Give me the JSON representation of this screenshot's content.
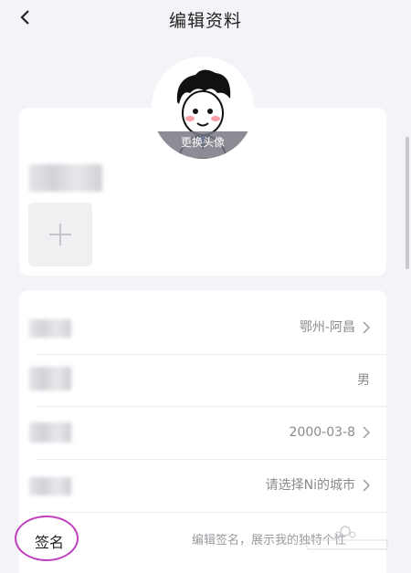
{
  "header": {
    "title": "编辑资料"
  },
  "avatar": {
    "change_label": "更换头像"
  },
  "rows": [
    {
      "value": "鄂州-阿昌"
    },
    {
      "value": "男"
    },
    {
      "value": "2000-03-8"
    },
    {
      "value": "请选择Ni的城市"
    }
  ],
  "signature": {
    "label": "签名",
    "placeholder": "编辑签名，展示我的独特个性"
  },
  "colors": {
    "accent": "#c040c0",
    "background": "#f4f4f8",
    "card": "#ffffff"
  },
  "icons": [
    "back-icon",
    "plus-icon",
    "chevron-right-icon"
  ]
}
